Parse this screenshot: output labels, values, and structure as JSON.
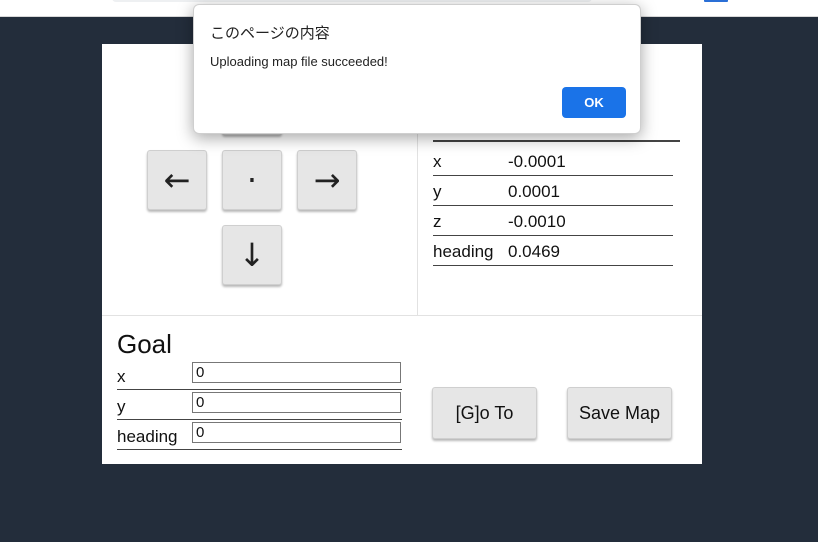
{
  "dialog": {
    "title": "このページの内容",
    "message": "Uploading map file succeeded!",
    "ok_label": "OK"
  },
  "dpad": {
    "left": "←",
    "center": "·",
    "right": "→",
    "down": "↓"
  },
  "pose": {
    "rows": [
      {
        "key": "x",
        "value": "-0.0001"
      },
      {
        "key": "y",
        "value": "0.0001"
      },
      {
        "key": "z",
        "value": "-0.0010"
      },
      {
        "key": "heading",
        "value": "0.0469"
      }
    ]
  },
  "goal": {
    "title": "Goal",
    "rows": [
      {
        "key": "x",
        "value": "0"
      },
      {
        "key": "y",
        "value": "0"
      },
      {
        "key": "heading",
        "value": "0"
      }
    ]
  },
  "actions": {
    "goto_label": "[G]o To",
    "save_map_label": "Save Map"
  },
  "colors": {
    "background": "#232d3b",
    "dialog_button": "#1a73e8"
  }
}
